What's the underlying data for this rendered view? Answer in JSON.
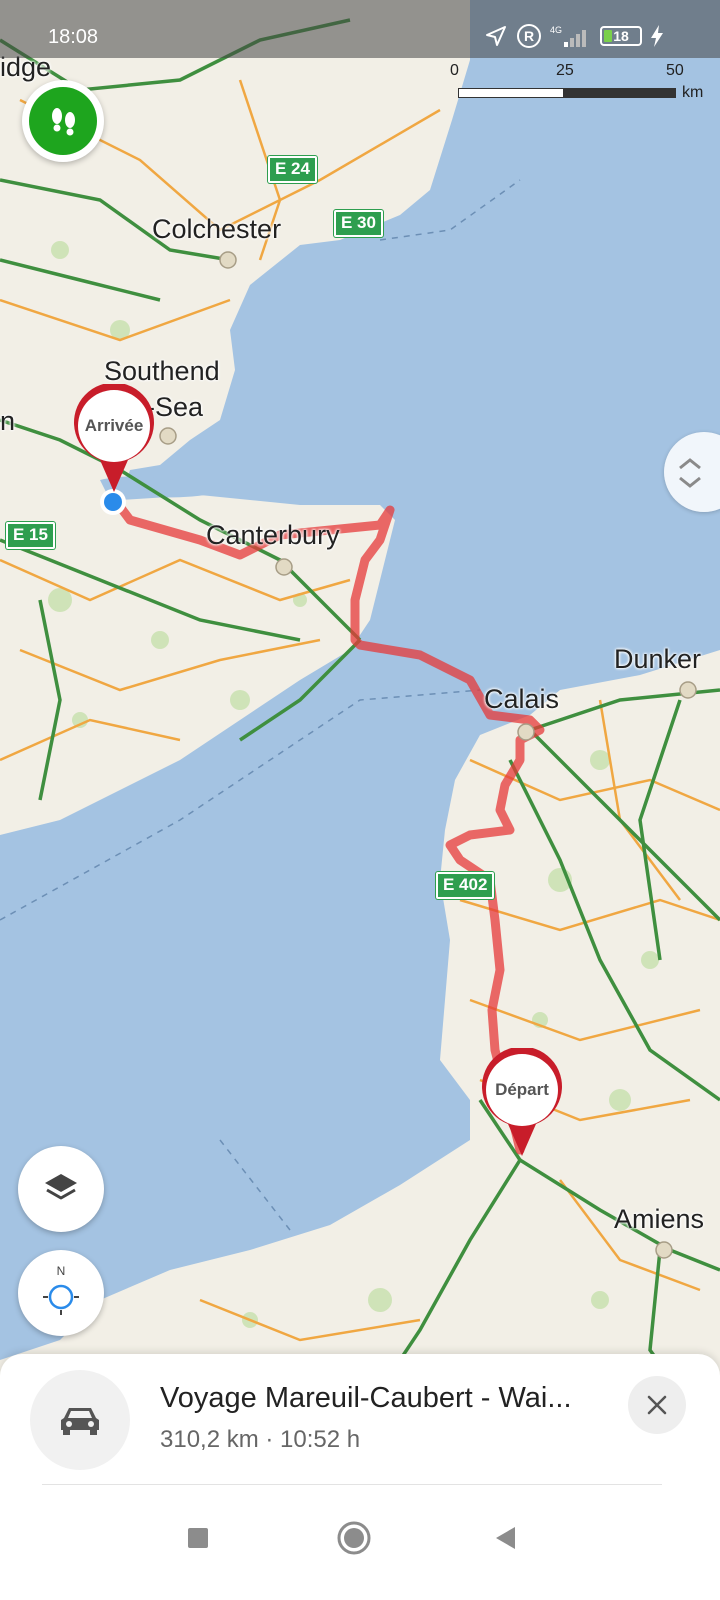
{
  "status_bar": {
    "time": "18:08",
    "network": "4G",
    "battery": "18"
  },
  "scale": {
    "ticks": [
      "0",
      "25",
      "50"
    ],
    "unit": "km"
  },
  "map": {
    "cities": {
      "cambridge": "idge",
      "colchester": "Colchester",
      "southend_1": "Southend",
      "southend_2": "-Sea",
      "london": "n",
      "canterbury": "Canterbury",
      "calais": "Calais",
      "dunkerque": "Dunker",
      "amiens": "Amiens"
    },
    "roads": {
      "e24": "E 24",
      "e30": "E 30",
      "e15": "E 15",
      "e402": "E 402"
    },
    "pins": {
      "arrival": "Arrivée",
      "departure": "Départ"
    },
    "colors": {
      "route": "#e53a3a",
      "sea": "#a4c3e2",
      "land": "#f2efe6"
    }
  },
  "controls": {
    "walk_icon": "footprints-icon",
    "layers_icon": "layers-icon",
    "compass_label": "N",
    "zoom_icon": "chevron-up-down-icon"
  },
  "trip": {
    "title": "Voyage Mareuil-Caubert - Wai...",
    "meta": "310,2 km · 10:52 h",
    "vehicle_icon": "car-icon",
    "close_icon": "close-icon"
  },
  "nav": {
    "recents_icon": "square-icon",
    "home_icon": "circle-icon",
    "back_icon": "triangle-back-icon"
  }
}
